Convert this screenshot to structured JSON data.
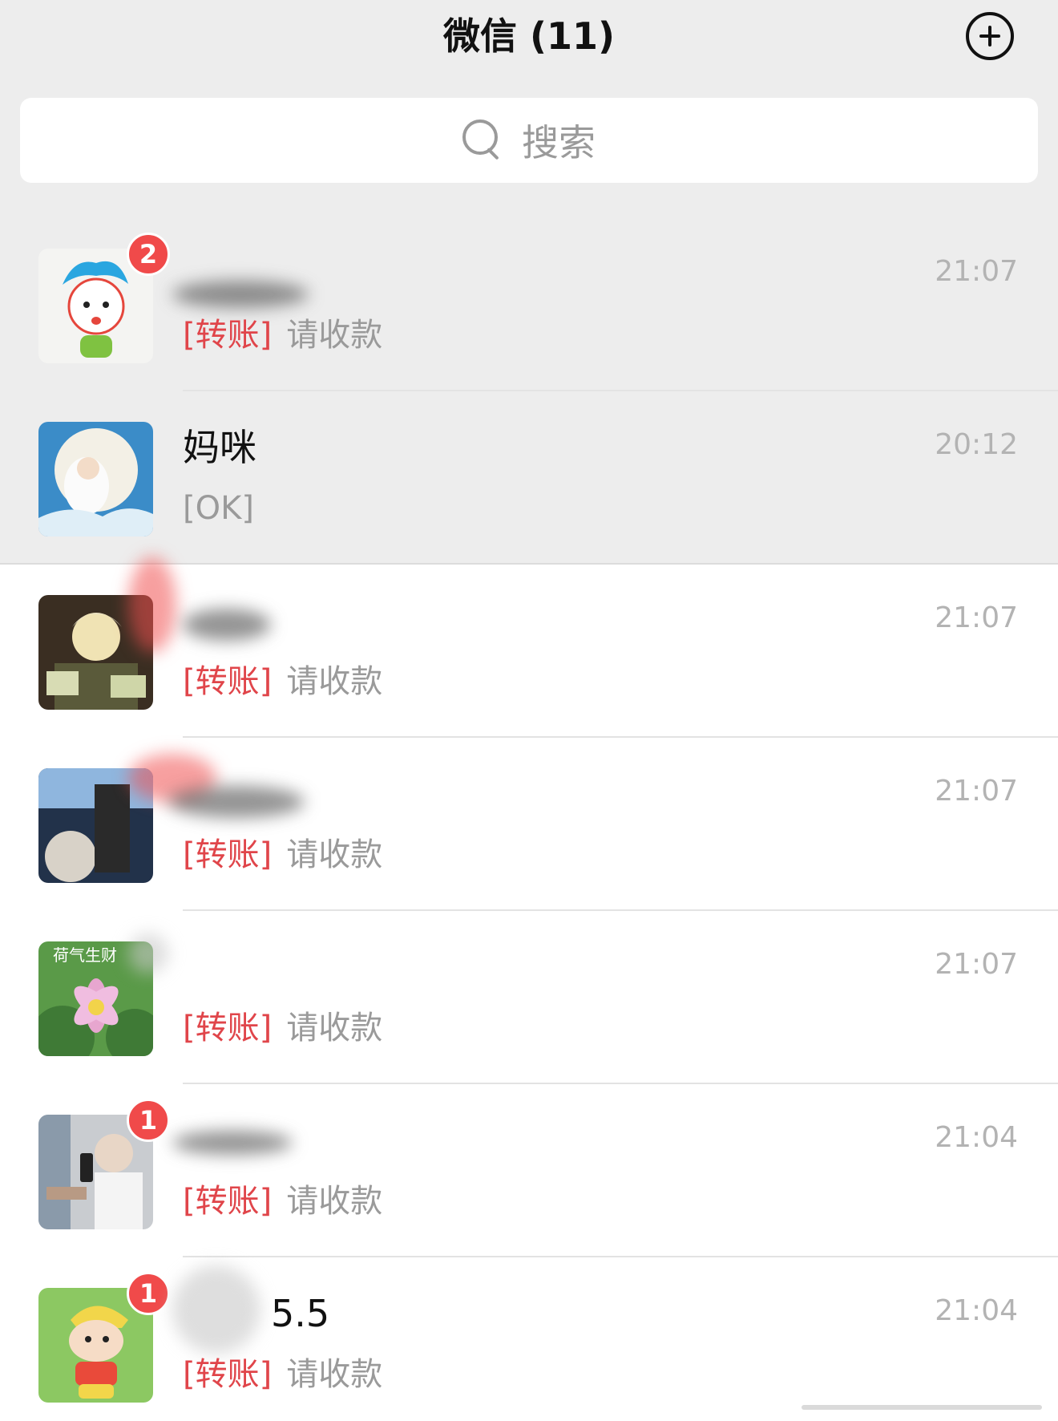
{
  "header": {
    "title": "微信 (11)",
    "add_icon": "plus-circle-icon"
  },
  "search": {
    "placeholder": "搜索",
    "icon": "search-icon"
  },
  "chats": [
    {
      "name": "",
      "time": "21:07",
      "tag": "[转账]",
      "message": "请收款",
      "unread": "2",
      "pinned": true
    },
    {
      "name": "妈咪",
      "time": "20:12",
      "tag": "",
      "message": "[OK]",
      "unread": "",
      "pinned": true
    },
    {
      "name": "",
      "time": "21:07",
      "tag": "[转账]",
      "message": "请收款",
      "unread": "",
      "pinned": false
    },
    {
      "name": "",
      "time": "21:07",
      "tag": "[转账]",
      "message": "请收款",
      "unread": "",
      "pinned": false
    },
    {
      "name": "",
      "time": "21:07",
      "tag": "[转账]",
      "message": "请收款",
      "unread": "",
      "pinned": false,
      "avatar_text": "荷气生财"
    },
    {
      "name": "",
      "time": "21:04",
      "tag": "[转账]",
      "message": "请收款",
      "unread": "1",
      "pinned": false
    },
    {
      "name": "5.5",
      "time": "21:04",
      "tag": "[转账]",
      "message": "请收款",
      "unread": "1",
      "pinned": false
    }
  ],
  "colors": {
    "header_bg": "#ededed",
    "transfer_tag": "#e0454a",
    "badge": "#f04a4a"
  }
}
